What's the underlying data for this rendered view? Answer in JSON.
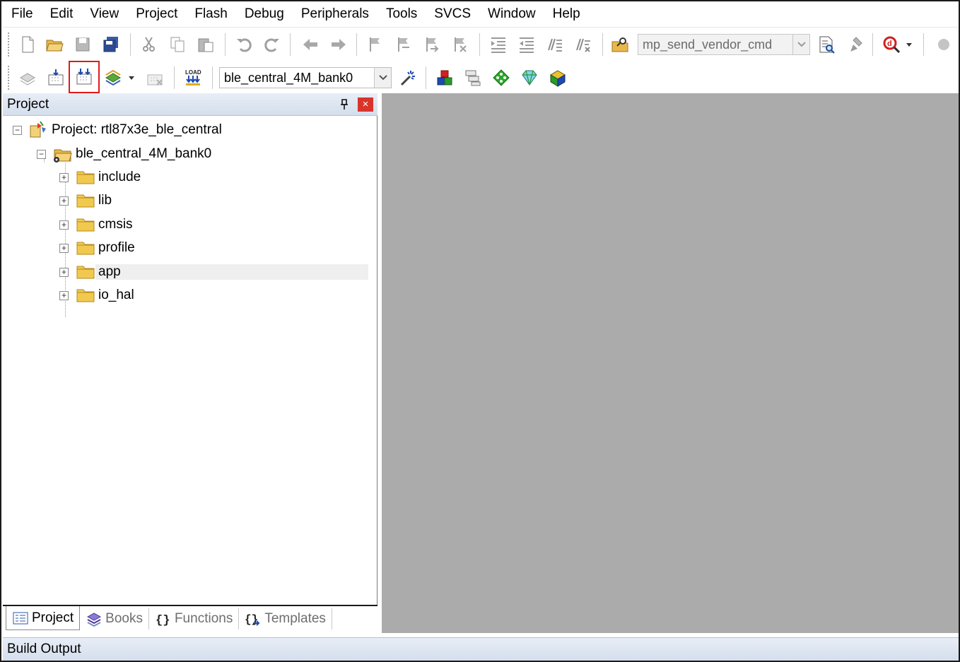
{
  "menu": [
    "File",
    "Edit",
    "View",
    "Project",
    "Flash",
    "Debug",
    "Peripherals",
    "Tools",
    "SVCS",
    "Window",
    "Help"
  ],
  "toolbar1": {
    "find_combo_value": "mp_send_vendor_cmd"
  },
  "toolbar2": {
    "target_combo_value": "ble_central_4M_bank0",
    "load_label": "LOAD"
  },
  "project_panel": {
    "title": "Project",
    "close_glyph": "×",
    "root_label": "Project: rtl87x3e_ble_central",
    "target_label": "ble_central_4M_bank0",
    "groups": [
      {
        "label": "include",
        "selected": false
      },
      {
        "label": "lib",
        "selected": false
      },
      {
        "label": "cmsis",
        "selected": false
      },
      {
        "label": "profile",
        "selected": false
      },
      {
        "label": "app",
        "selected": true
      },
      {
        "label": "io_hal",
        "selected": false
      }
    ],
    "tabs": [
      {
        "label": "Project",
        "icon": "project-tab-icon",
        "active": true
      },
      {
        "label": "Books",
        "icon": "books-icon",
        "active": false
      },
      {
        "label": "Functions",
        "icon": "braces-icon",
        "active": false
      },
      {
        "label": "Templates",
        "icon": "templates-icon",
        "active": false
      }
    ]
  },
  "build_output": {
    "title": "Build Output"
  },
  "colors": {
    "editor_bg": "#ababab",
    "highlight_box": "#e01a1a",
    "panel_header": "#d4deec",
    "close_button": "#d9342b"
  }
}
